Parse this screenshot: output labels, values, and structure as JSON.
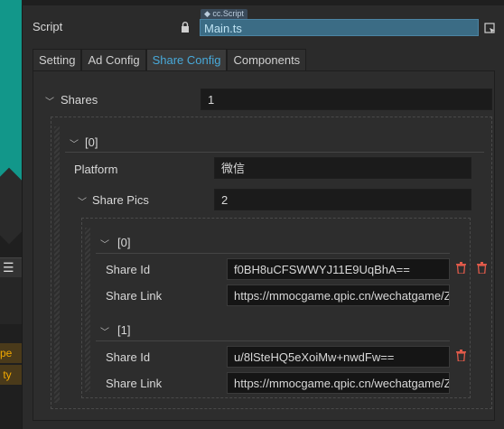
{
  "left_panel": {
    "menu_icon": "menu-icon",
    "truncated_1": "ype",
    "truncated_2": "s ty"
  },
  "script": {
    "label": "Script",
    "tag": "cc.Script",
    "value": "Main.ts"
  },
  "tabs": [
    {
      "label": "Setting"
    },
    {
      "label": "Ad Config"
    },
    {
      "label": "Share Config"
    },
    {
      "label": "Components"
    }
  ],
  "active_tab": "Share Config",
  "shares": {
    "label": "Shares",
    "count": "1",
    "item0": {
      "label": "[0]",
      "platform_label": "Platform",
      "platform_value": "微信",
      "share_pics": {
        "label": "Share Pics",
        "count": "2",
        "items": [
          {
            "label": "[0]",
            "id_label": "Share Id",
            "id_value": "f0BH8uCFSWWYJ11E9UqBhA==",
            "link_label": "Share Link",
            "link_value": "https://mmocgame.qpic.cn/wechatgame/ZMH"
          },
          {
            "label": "[1]",
            "id_label": "Share Id",
            "id_value": "u/8lSteHQ5eXoiMw+nwdFw==",
            "link_label": "Share Link",
            "link_value": "https://mmocgame.qpic.cn/wechatgame/ZMH"
          }
        ]
      }
    }
  },
  "colors": {
    "accent": "#48a9d9",
    "script_field": "#3b6c85",
    "trash": "#e05a4a",
    "warning": "#f2a900"
  }
}
